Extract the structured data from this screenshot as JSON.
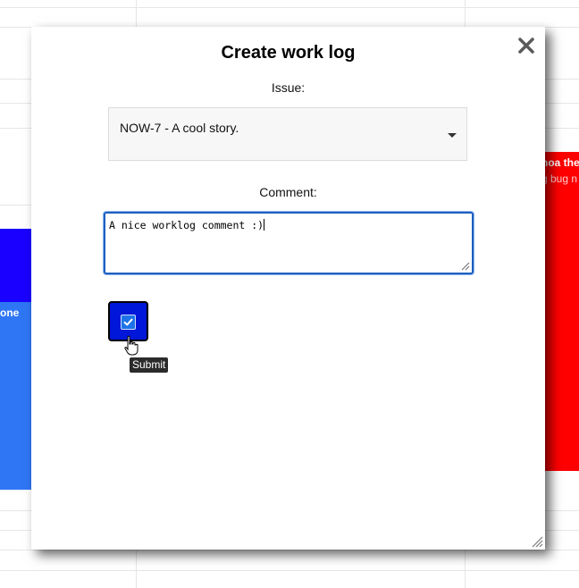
{
  "background": {
    "card_blue_light_text": "one",
    "card_red_text_1": "noa the",
    "card_red_text_2": "g bug n"
  },
  "modal": {
    "title": "Create work log",
    "issue_label": "Issue:",
    "issue_selected": "NOW-7 - A cool story.",
    "comment_label": "Comment:",
    "comment_value": "A nice worklog comment :)",
    "submit_tooltip": "Submit"
  },
  "colors": {
    "submit_button": "#0016d8",
    "card_blue_dark": "#1a00ff",
    "card_blue_light": "#2f76f5",
    "card_red": "#ff0000",
    "textarea_focus_border": "#1f5fbf"
  },
  "icons": {
    "close": "close-icon",
    "dropdown": "caret-down-icon",
    "submit": "checkbox-checked-icon",
    "cursor": "hand-pointer-icon",
    "resize": "resize-grip-icon"
  }
}
